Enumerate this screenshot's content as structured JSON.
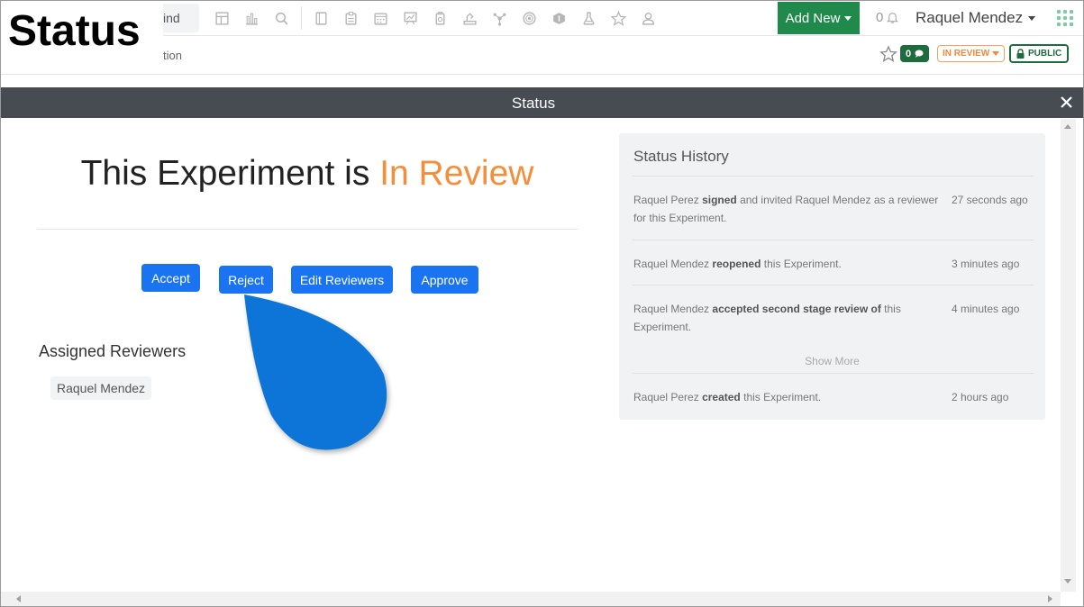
{
  "overlay_label": "Status",
  "topnav": {
    "find_text": "ind",
    "icons": [
      "dashboard-icon",
      "reports-icon",
      "search-icon",
      "notebook-icon",
      "protocol-icon",
      "calendar-icon",
      "presentation-icon",
      "sample-icon",
      "equipment-icon",
      "molecule-icon",
      "target-icon",
      "sequence-icon",
      "flask-icon",
      "favorites-icon",
      "people-icon"
    ],
    "add_new_label": "Add New",
    "notification_count": "0",
    "user_name": "Raquel Mendez"
  },
  "subbar": {
    "breadcrumb_text": "tion",
    "comment_count": "0",
    "status_label": "IN REVIEW",
    "visibility_label": "PUBLIC"
  },
  "modal": {
    "title": "Status",
    "headline_prefix": "This Experiment is",
    "headline_status": "In Review",
    "buttons": {
      "accept": "Accept",
      "reject": "Reject",
      "edit_reviewers": "Edit Reviewers",
      "approve": "Approve"
    },
    "assigned_reviewers_title": "Assigned Reviewers",
    "reviewers": [
      "Raquel Mendez"
    ]
  },
  "history": {
    "title": "Status History",
    "entries": [
      {
        "actor": "Raquel Perez",
        "action": "signed",
        "rest": "and invited Raquel Mendez as a reviewer for this Experiment.",
        "time": "27 seconds ago"
      },
      {
        "actor": "Raquel Mendez",
        "action": "reopened",
        "rest": "this Experiment.",
        "time": "3 minutes ago"
      },
      {
        "actor": "Raquel Mendez",
        "action": "accepted second stage review of",
        "rest": "this Experiment.",
        "time": "4 minutes ago"
      },
      {
        "actor": "Raquel Perez",
        "action": "created",
        "rest": "this Experiment.",
        "time": "2 hours ago"
      }
    ],
    "show_more_label": "Show More"
  },
  "colors": {
    "accent_green": "#1f8a4c",
    "button_blue": "#1a73f0",
    "status_orange": "#f58e3a",
    "modal_header": "#474c53",
    "callout_blue": "#0b74d8"
  }
}
